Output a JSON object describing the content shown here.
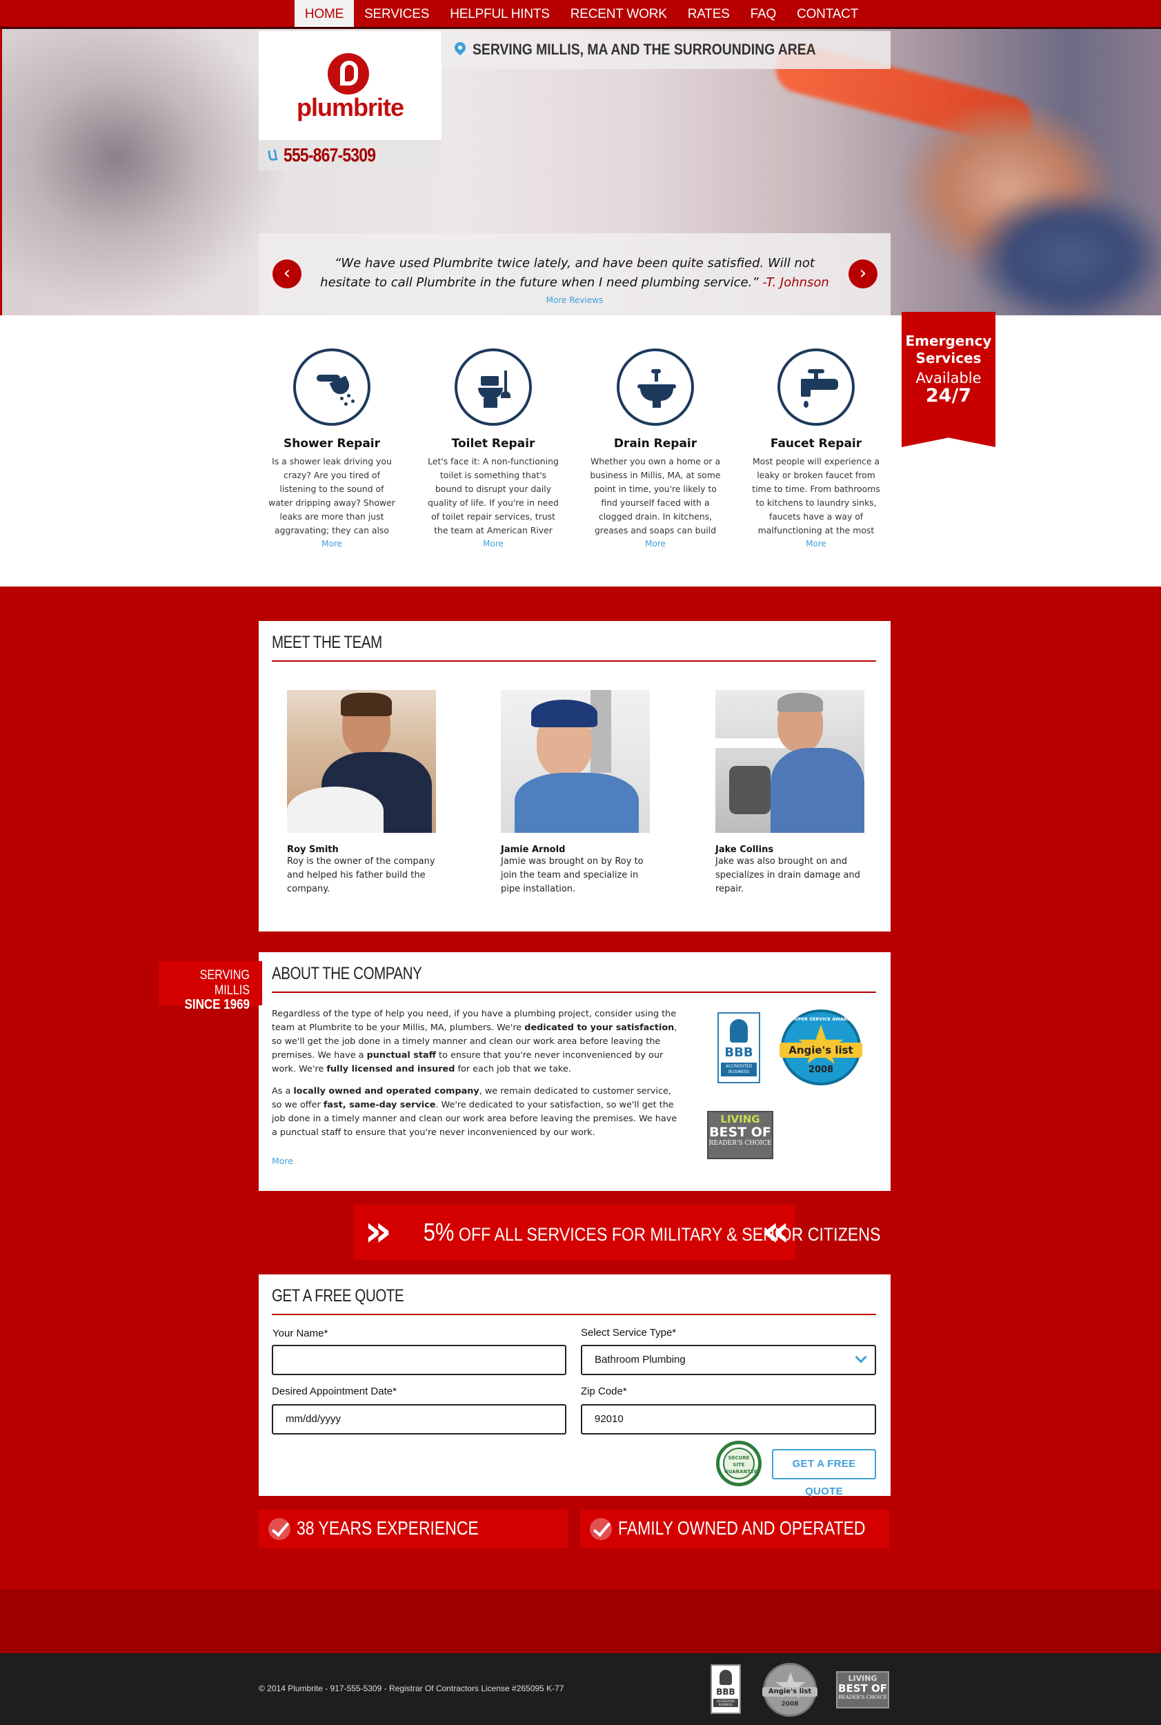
{
  "nav": {
    "items": [
      "HOME",
      "SERVICES",
      "HELPFUL HINTS",
      "RECENT WORK",
      "RATES",
      "FAQ",
      "CONTACT"
    ],
    "active": "HOME"
  },
  "header": {
    "logo_text": "plumbrite",
    "phone": "555-867-5309",
    "service_area": "SERVING MILLIS, MA AND THE SURROUNDING AREA"
  },
  "review": {
    "quote": "We have used Plumbrite twice lately, and have been quite satisfied. Will not hesitate to call Plumbrite in the future when I need plumbing service.",
    "author": "-T. Johnson",
    "more_link": "More Reviews",
    "prev_icon": "chevron-left-icon",
    "next_icon": "chevron-right-icon"
  },
  "emergency": {
    "line1": "Emergency",
    "line2": "Services",
    "line3": "Available",
    "line4": "24/7"
  },
  "services": [
    {
      "title": "Shower Repair",
      "icon": "shower-icon",
      "text": "Is a shower leak driving you crazy? Are you tired of listening to the sound of water dripping away? Shower leaks are more than just aggravating; they can also cost you money. Believe…",
      "more": "More"
    },
    {
      "title": "Toilet Repair",
      "icon": "toilet-icon",
      "text": "Let's face it: A non-functioning toilet is something that's bound to disrupt your daily quality of life. If you're in need of toilet repair services, trust the team at American River Plumbing to…",
      "more": "More"
    },
    {
      "title": "Drain Repair",
      "icon": "sink-drain-icon",
      "text": "Whether you own a home or a business in Millis, MA, at some point in time, you're likely to find yourself faced with a clogged drain. In kitchens, greases and soaps can build up on the…",
      "more": "More"
    },
    {
      "title": "Faucet Repair",
      "icon": "faucet-icon",
      "text": "Most people will experience a leaky or broken faucet from time to time. From bathrooms to kitchens to laundry sinks, faucets have a way of malfunctioning at the most inconvenient of times…",
      "more": "More"
    }
  ],
  "team": {
    "title": "MEET THE TEAM",
    "members": [
      {
        "name": "Roy Smith",
        "desc": "Roy is the owner of the company and helped his father build the company."
      },
      {
        "name": "Jamie Arnold",
        "desc": "Jamie was brought on by Roy to join the team and specialize in pipe installation."
      },
      {
        "name": "Jake Collins",
        "desc": "Jake was also brought on and specializes in drain damage and repair."
      }
    ]
  },
  "serving_tag": {
    "line1": "SERVING MILLIS",
    "line2": "SINCE 1969"
  },
  "about": {
    "title": "ABOUT THE COMPANY",
    "p1_a": "Regardless of the type of help you need, if you have a plumbing project, consider using the team at Plumbrite to be your Millis, MA, plumbers. We're ",
    "p1_b": "dedicated to your satisfaction",
    "p1_c": ", so we'll get the job done in a timely manner and clean our work area before leaving the premises. We have a ",
    "p1_d": "punctual staff",
    "p1_e": " to ensure that you're never inconvenienced by our work. We're ",
    "p1_f": "fully licensed and insured",
    "p1_g": " for each job that we take.",
    "p2_a": "As a ",
    "p2_b": "locally owned and operated company",
    "p2_c": ", we remain dedicated to customer service, so we offer ",
    "p2_d": "fast, same-day service",
    "p2_e": ". We're dedicated to your satisfaction, so we'll get the job done in a timely manner and clean our work area before leaving the premises. We have a punctual staff to ensure that you're never inconvenienced by our work.",
    "more": "More",
    "bbb_top": "BBB",
    "bbb_sub": "ACCREDITED BUSINESS",
    "angie_top": "SUPER SERVICE AWARD",
    "angie_name": "Angie's list",
    "angie_year": "2008",
    "living_1": "LIVING",
    "living_2": "BEST OF",
    "living_3": "READER'S CHOICE"
  },
  "promo": {
    "percent": "5%",
    "text": " OFF ALL SERVICES FOR MILITARY & SENIOR CITIZENS"
  },
  "quote_form": {
    "title": "GET A FREE QUOTE",
    "name_label": "Your Name*",
    "name_value": "",
    "service_label": "Select Service Type*",
    "service_value": "Bathroom Plumbing",
    "date_label": "Desired Appointment Date*",
    "date_value": "mm/dd/yyyy",
    "zip_label": "Zip Code*",
    "zip_value": "92010",
    "secure_text": "SECURE SITE GUARANTEE",
    "submit": "GET A FREE QUOTE"
  },
  "features": [
    "38 YEARS EXPERIENCE",
    "FAMILY OWNED AND OPERATED"
  ],
  "footer": {
    "copyright": "© 2014  Plumbrite - 917-555-5309 - Registrar Of Contractors License #265095 K-77"
  },
  "colors": {
    "brand_red": "#b80000",
    "accent_red": "#d40000",
    "link_blue": "#3fa0d8",
    "icon_navy": "#1d3a5c",
    "footer_dark": "#1e1e20"
  }
}
